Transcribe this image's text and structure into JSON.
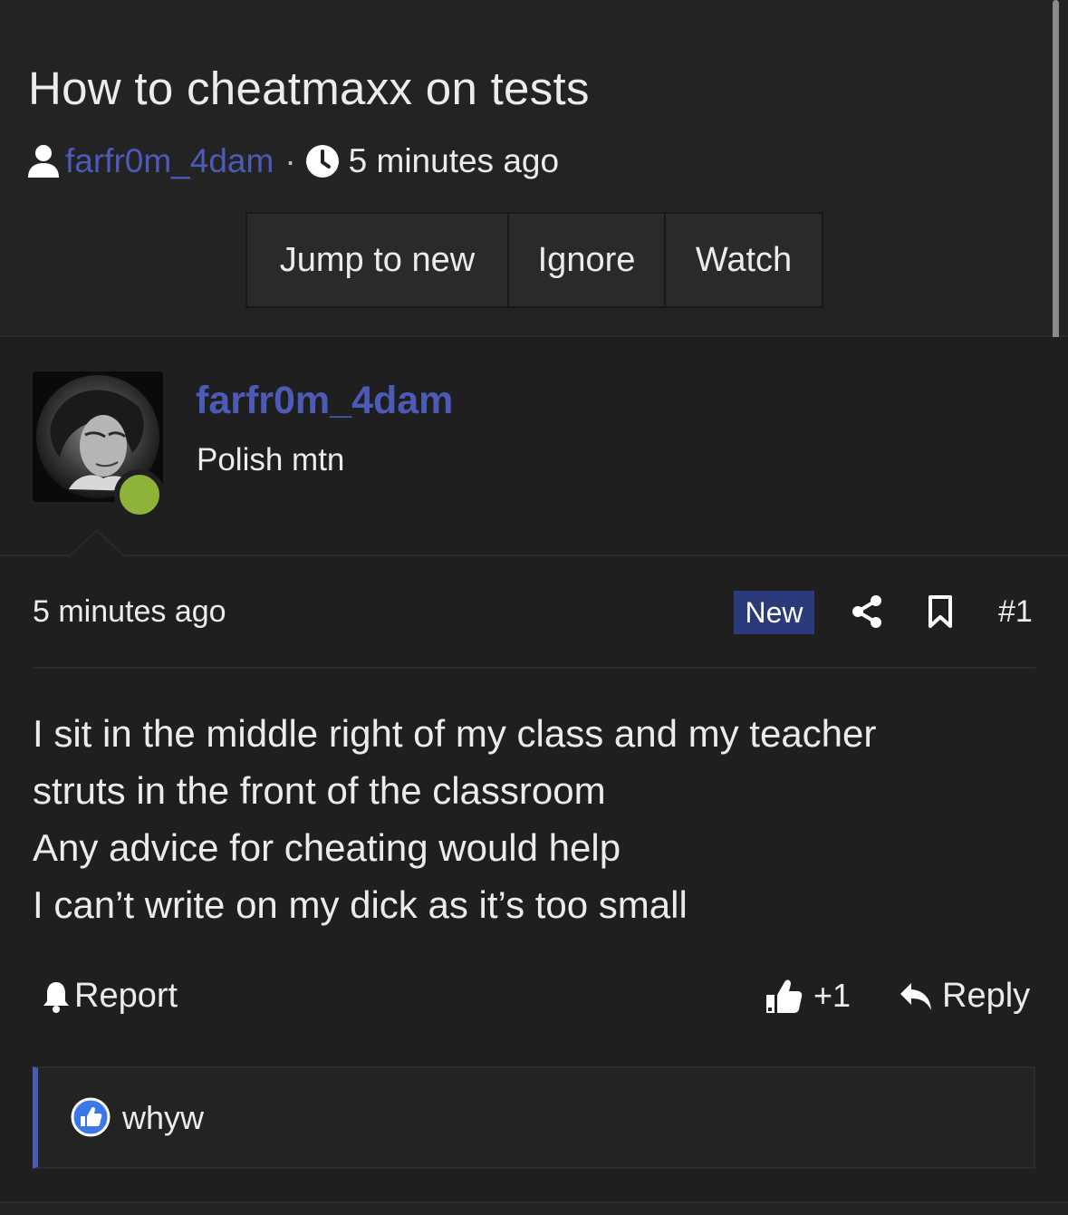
{
  "thread": {
    "title": "How to cheatmaxx on tests",
    "author": "farfr0m_4dam",
    "separator": "·",
    "time": "5 minutes ago"
  },
  "thread_actions": {
    "jump_label": "Jump to new",
    "ignore_label": "Ignore",
    "watch_label": "Watch"
  },
  "post": {
    "username": "farfr0m_4dam",
    "user_title": "Polish mtn",
    "online_status": "online",
    "time": "5 minutes ago",
    "badge": "New",
    "number": "#1",
    "body_lines": [
      "I sit in the middle right of my class and my teacher",
      "struts in the front of the classroom",
      "Any advice for cheating would help",
      "I can’t write on my dick as it’s too small"
    ],
    "report_label": "Report",
    "like_count": "+1",
    "reply_label": "Reply"
  },
  "reactions": {
    "icon": "like-reaction-icon",
    "users": "whyw"
  },
  "colors": {
    "background": "#1f1f20",
    "header": "#232324",
    "link": "#4d5bb8",
    "new_badge": "#2b3a7a",
    "online": "#8fb338"
  },
  "icons": [
    "user-icon",
    "clock-icon",
    "share-icon",
    "bookmark-icon",
    "bell-icon",
    "thumbs-up-icon",
    "reply-icon"
  ]
}
